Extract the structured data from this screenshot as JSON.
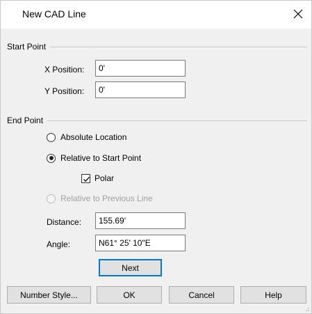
{
  "window": {
    "title": "New CAD Line",
    "close_icon": "close-icon"
  },
  "start_point": {
    "group_label": "Start Point",
    "x_label": "X Position:",
    "x_value": "0'",
    "y_label": "Y Position:",
    "y_value": "0'"
  },
  "end_point": {
    "group_label": "End Point",
    "options": [
      {
        "label": "Absolute Location",
        "checked": false,
        "enabled": true
      },
      {
        "label": "Relative to Start Point",
        "checked": true,
        "enabled": true
      },
      {
        "label": "Relative to Previous Line",
        "checked": false,
        "enabled": false
      }
    ],
    "polar_label": "Polar",
    "polar_checked": true,
    "distance_label": "Distance:",
    "distance_value": "155.69'",
    "angle_label": "Angle:",
    "angle_value": "N61° 25' 10\"E",
    "next_label": "Next"
  },
  "buttons": {
    "number_style": "Number Style...",
    "ok": "OK",
    "cancel": "Cancel",
    "help": "Help"
  },
  "colors": {
    "accent": "#0078d7",
    "dialog_bg": "#f0f0f0",
    "disabled_text": "#a0a0a0"
  }
}
